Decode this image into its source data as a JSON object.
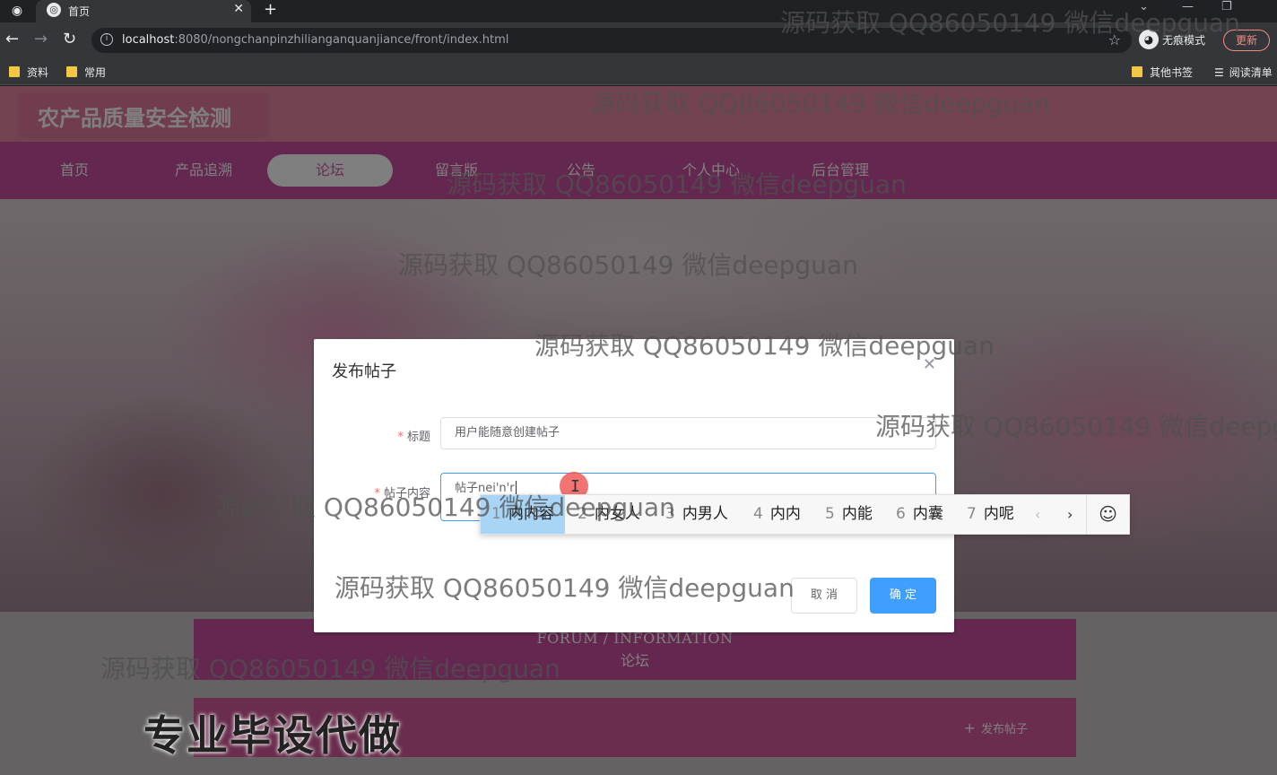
{
  "browser": {
    "tab_title": "首页",
    "url_host": "localhost",
    "url_rest": ":8080/nongchanpinzhilianganquanjiance/front/index.html",
    "incognito_label": "无痕模式",
    "update_label": "更新",
    "bookmarks": [
      "资料",
      "常用"
    ],
    "bookmarks_right": [
      "其他书签",
      "阅读清单"
    ]
  },
  "site": {
    "logo": "农产品质量安全检测",
    "nav": [
      "首页",
      "产品追溯",
      "论坛",
      "留言版",
      "公告",
      "个人中心",
      "后台管理"
    ],
    "active_nav": "论坛",
    "section_en": "FORUM / INFORMATION",
    "section_zh": "论坛",
    "post_button": "发布帖子"
  },
  "dialog": {
    "title": "发布帖子",
    "fields": [
      {
        "label": "标题",
        "value": "用户能随意创建帖子",
        "required": true
      },
      {
        "label": "帖子内容",
        "value": "帖子nei'n'r",
        "required": true
      }
    ],
    "cancel": "取 消",
    "ok": "确 定"
  },
  "ime": {
    "candidates": [
      {
        "num": "1",
        "text": "内内容"
      },
      {
        "num": "2",
        "text": "内女人"
      },
      {
        "num": "3",
        "text": "内男人"
      },
      {
        "num": "4",
        "text": "内内"
      },
      {
        "num": "5",
        "text": "内能"
      },
      {
        "num": "6",
        "text": "内囊"
      },
      {
        "num": "7",
        "text": "内呢"
      }
    ]
  },
  "watermark": "源码获取 QQ86050149 微信deepguan",
  "banner": "专业毕设代做",
  "colors": {
    "accent": "#409eff",
    "nav": "#c94fa0",
    "header": "#e887a3"
  }
}
